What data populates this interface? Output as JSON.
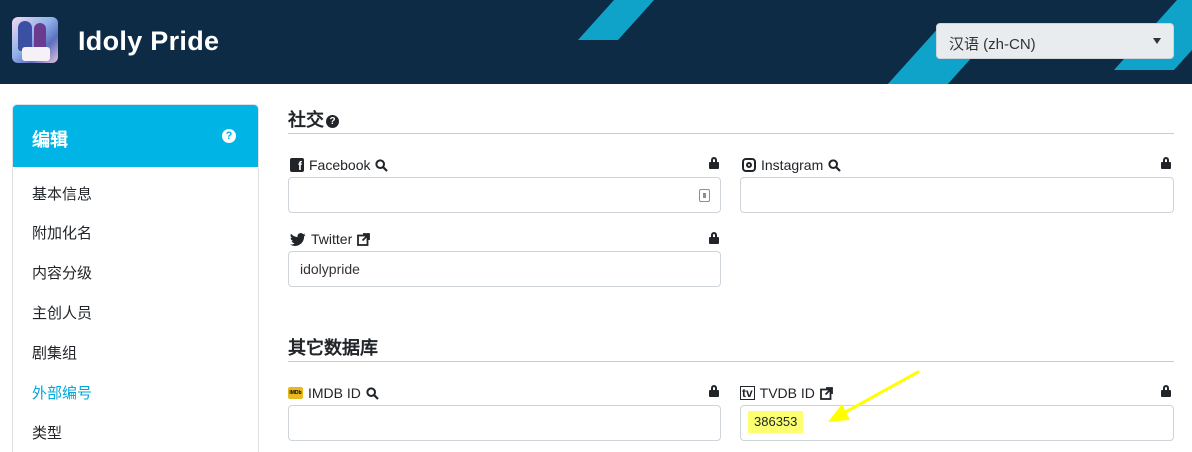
{
  "header": {
    "site_title": "Idoly Pride",
    "language_selected": "汉语 (zh-CN)"
  },
  "sidebar": {
    "title": "编辑",
    "items": [
      {
        "label": "基本信息",
        "active": false
      },
      {
        "label": "附加化名",
        "active": false
      },
      {
        "label": "内容分级",
        "active": false
      },
      {
        "label": "主创人员",
        "active": false
      },
      {
        "label": "剧集组",
        "active": false
      },
      {
        "label": "外部编号",
        "active": true
      },
      {
        "label": "类型",
        "active": false
      }
    ]
  },
  "social": {
    "title": "社交",
    "facebook": {
      "label": "Facebook",
      "value": ""
    },
    "instagram": {
      "label": "Instagram",
      "value": ""
    },
    "twitter": {
      "label": "Twitter",
      "value": "idolypride"
    }
  },
  "other_databases": {
    "title": "其它数据库",
    "imdb": {
      "label": "IMDB ID",
      "value": "",
      "badge": "IMDb"
    },
    "tvdb": {
      "label": "TVDB ID",
      "value": "386353",
      "badge": "tv"
    }
  },
  "colors": {
    "header_bg": "#0d2b45",
    "accent": "#00b4e6",
    "highlight": "#fcff70",
    "arrow": "#ffff00"
  }
}
